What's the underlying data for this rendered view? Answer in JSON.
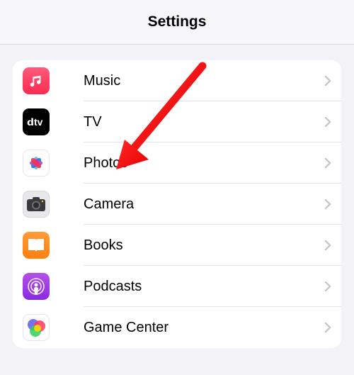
{
  "header": {
    "title": "Settings"
  },
  "rows": [
    {
      "id": "music",
      "label": "Music",
      "iconName": "music-icon"
    },
    {
      "id": "tv",
      "label": "TV",
      "iconName": "tv-icon"
    },
    {
      "id": "photos",
      "label": "Photos",
      "iconName": "photos-icon"
    },
    {
      "id": "camera",
      "label": "Camera",
      "iconName": "camera-icon"
    },
    {
      "id": "books",
      "label": "Books",
      "iconName": "books-icon"
    },
    {
      "id": "podcasts",
      "label": "Podcasts",
      "iconName": "podcasts-icon"
    },
    {
      "id": "gamecenter",
      "label": "Game Center",
      "iconName": "gamecenter-icon"
    }
  ],
  "annotation": {
    "arrowTarget": "photos"
  }
}
